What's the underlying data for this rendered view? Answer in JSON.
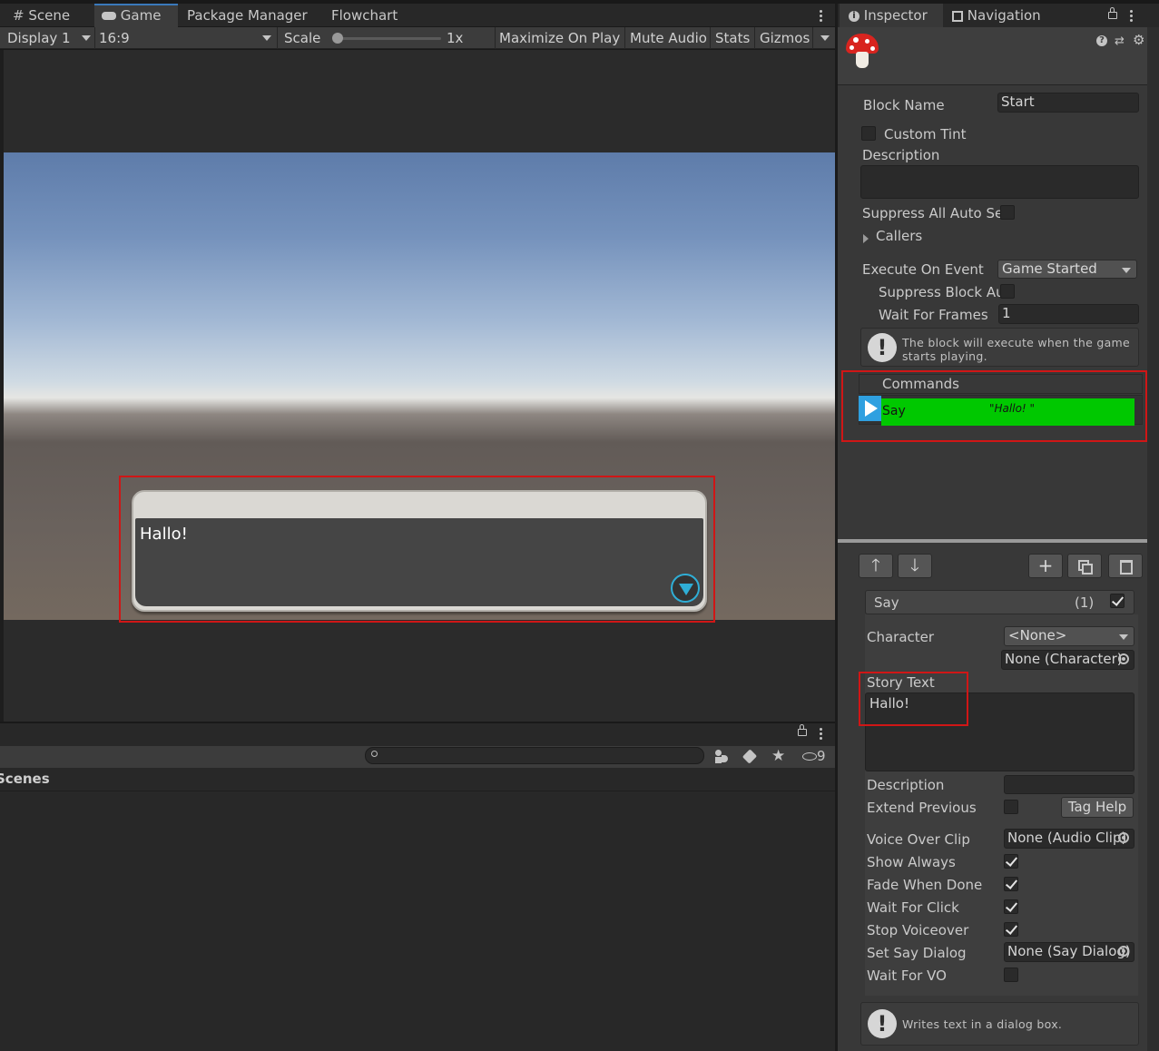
{
  "game_panel": {
    "tabs": [
      {
        "label": "Scene"
      },
      {
        "label": "Game"
      },
      {
        "label": "Package Manager"
      },
      {
        "label": "Flowchart"
      }
    ],
    "toolbar": {
      "display": "Display 1",
      "aspect": "16:9",
      "scale_label": "Scale",
      "scale_value": "1x",
      "scale_level": 0.0,
      "maximize": "Maximize On Play",
      "mute": "Mute Audio",
      "stats": "Stats",
      "gizmos": "Gizmos"
    },
    "dialog_text": "Hallo!"
  },
  "project_panel": {
    "search_placeholder": "",
    "hidden_count": "9",
    "row_label": "Scenes"
  },
  "inspector": {
    "tabs": [
      {
        "label": "Inspector"
      },
      {
        "label": "Navigation"
      }
    ],
    "block_name_label": "Block Name",
    "block_name_value": "Start",
    "custom_tint_label": "Custom Tint",
    "description_label": "Description",
    "description_value": "",
    "suppress_all_label": "Suppress All Auto Se",
    "callers_label": "Callers",
    "execute_on_event_label": "Execute On Event",
    "execute_on_event_value": "Game Started",
    "suppress_block_label": "Suppress Block Au",
    "wait_for_frames_label": "Wait For Frames",
    "wait_for_frames_value": "1",
    "event_help": "The block will execute when the game starts playing.",
    "commands_label": "Commands",
    "command": {
      "name": "Say",
      "summary": "\"Hallo! \"",
      "color": "#00c800"
    },
    "say_header": {
      "name": "Say",
      "index": "(1)"
    },
    "character_label": "Character",
    "character_value": "<None>",
    "character_object": "None (Character)",
    "story_text_label": "Story Text",
    "story_text_value": "Hallo!",
    "cmd_description_label": "Description",
    "cmd_description_value": "",
    "extend_previous_label": "Extend Previous",
    "tag_help": "Tag Help",
    "voice_over_label": "Voice Over Clip",
    "voice_over_value": "None (Audio Clip)",
    "show_always_label": "Show Always",
    "fade_when_done_label": "Fade When Done",
    "wait_for_click_label": "Wait For Click",
    "stop_voiceover_label": "Stop Voiceover",
    "set_say_dialog_label": "Set Say Dialog",
    "set_say_dialog_value": "None (Say Dialog)",
    "wait_for_vo_label": "Wait For VO",
    "say_help": "Writes text in a dialog box."
  },
  "colors": {
    "highlight": "#d01616",
    "accent": "#3a79bb",
    "command_green": "#00c800",
    "play_blue": "#2fa0e0"
  }
}
